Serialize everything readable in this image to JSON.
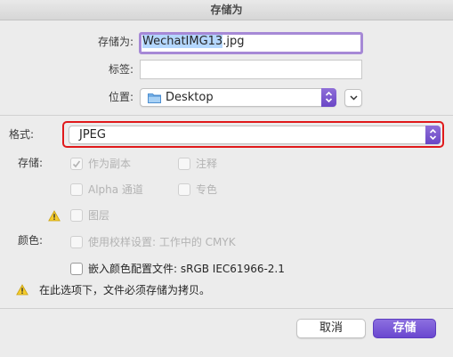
{
  "window": {
    "title": "存储为"
  },
  "form": {
    "save_as_label": "存储为:",
    "filename_selected": "WechatIMG13",
    "filename_ext": ".jpg",
    "tags_label": "标签:",
    "tags_value": "",
    "location_label": "位置:",
    "location_value": "Desktop"
  },
  "options": {
    "format_label": "格式:",
    "format_value": "JPEG",
    "storage_label": "存储:",
    "as_copy": "作为副本",
    "annotations": "注释",
    "alpha_channels": "Alpha 通道",
    "spot_colors": "专色",
    "layers": "图层",
    "color_label": "颜色:",
    "use_proof": "使用校样设置: 工作中的 CMYK",
    "embed_profile": "嵌入颜色配置文件: sRGB IEC61966-2.1",
    "warning": "在此选项下，文件必须存储为拷贝。"
  },
  "buttons": {
    "cancel": "取消",
    "save": "存储"
  },
  "colors": {
    "accent": "#6a47cf",
    "highlight": "#e0191b",
    "focus": "#a689d6"
  }
}
